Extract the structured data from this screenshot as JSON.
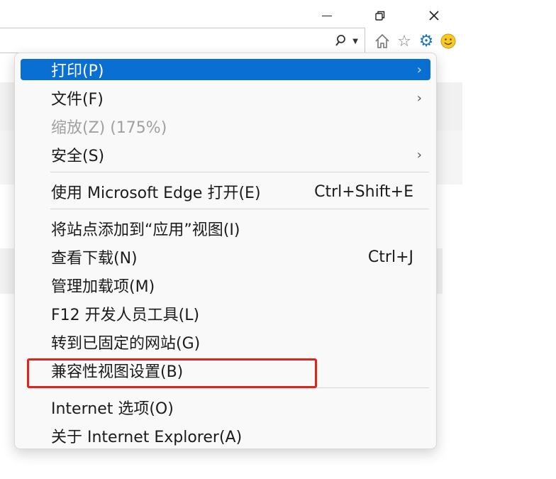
{
  "window": {
    "minimize_icon": "minimize-icon",
    "restore_icon": "restore-icon",
    "close_icon": "close-icon"
  },
  "address_bar": {
    "search_icon": "search-icon",
    "dropdown_icon": "chevron-down-icon"
  },
  "toolbar": {
    "icons": [
      "home-icon",
      "favorites-star-icon",
      "tools-gear-icon",
      "feedback-smiley-icon"
    ],
    "accent_color": "#1c75bc"
  },
  "menu": {
    "items": [
      {
        "label": "打印(P)",
        "submenu": true,
        "state": "selected"
      },
      {
        "label": "文件(F)",
        "submenu": true
      },
      {
        "label": "缩放(Z) (175%)",
        "state": "disabled"
      },
      {
        "label": "安全(S)",
        "submenu": true
      },
      {
        "label": "使用 Microsoft Edge 打开(E)",
        "shortcut": "Ctrl+Shift+E"
      },
      {
        "label": "将站点添加到“应用”视图(I)"
      },
      {
        "label": "查看下载(N)",
        "shortcut": "Ctrl+J"
      },
      {
        "label": "管理加载项(M)"
      },
      {
        "label": "F12 开发人员工具(L)"
      },
      {
        "label": "转到已固定的网站(G)"
      },
      {
        "label": "兼容性视图设置(B)",
        "annotated": true
      },
      {
        "label": "Internet 选项(O)"
      },
      {
        "label": "关于 Internet Explorer(A)"
      }
    ],
    "selection_color": "#0a6fd2",
    "annotation_color": "#e0241b"
  }
}
